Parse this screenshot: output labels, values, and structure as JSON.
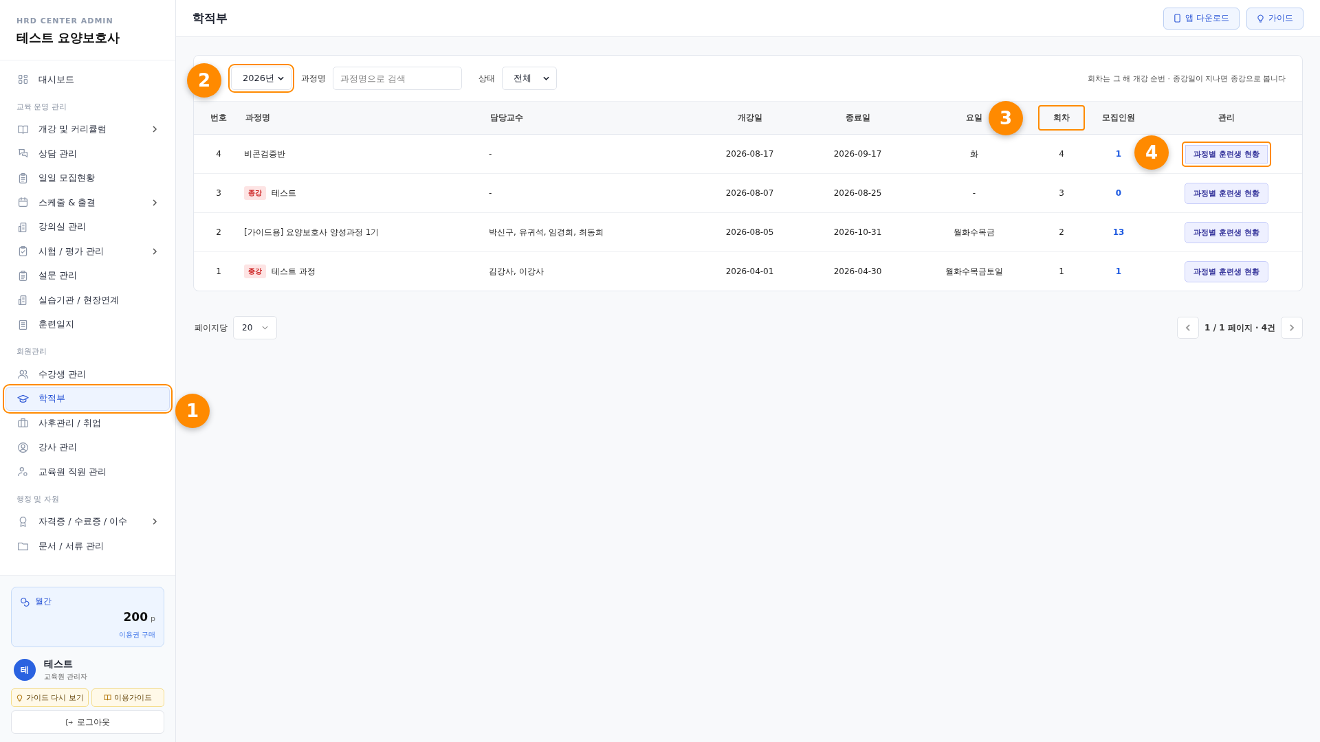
{
  "brand": {
    "subtitle": "HRD CENTER ADMIN",
    "title": "테스트 요양보호사"
  },
  "nav": [
    {
      "kind": "item",
      "label": "대시보드",
      "selected": false,
      "expandable": false,
      "highlighted": false
    },
    {
      "kind": "section",
      "label": "교육 운영 관리"
    },
    {
      "kind": "item",
      "label": "개강 및 커리큘럼",
      "selected": false,
      "expandable": true,
      "highlighted": false
    },
    {
      "kind": "item",
      "label": "상담 관리",
      "selected": false,
      "expandable": false,
      "highlighted": false
    },
    {
      "kind": "item",
      "label": "일일 모집현황",
      "selected": false,
      "expandable": false,
      "highlighted": false
    },
    {
      "kind": "item",
      "label": "스케줄 & 출결",
      "selected": false,
      "expandable": true,
      "highlighted": false
    },
    {
      "kind": "item",
      "label": "강의실 관리",
      "selected": false,
      "expandable": false,
      "highlighted": false
    },
    {
      "kind": "item",
      "label": "시험 / 평가 관리",
      "selected": false,
      "expandable": true,
      "highlighted": false
    },
    {
      "kind": "item",
      "label": "설문 관리",
      "selected": false,
      "expandable": false,
      "highlighted": false
    },
    {
      "kind": "item",
      "label": "실습기관 / 현장연계",
      "selected": false,
      "expandable": false,
      "highlighted": false
    },
    {
      "kind": "item",
      "label": "훈련일지",
      "selected": false,
      "expandable": false,
      "highlighted": false
    },
    {
      "kind": "section",
      "label": "회원관리"
    },
    {
      "kind": "item",
      "label": "수강생 관리",
      "selected": false,
      "expandable": false,
      "highlighted": false
    },
    {
      "kind": "item",
      "label": "학적부",
      "selected": true,
      "expandable": false,
      "highlighted": true
    },
    {
      "kind": "item",
      "label": "사후관리 / 취업",
      "selected": false,
      "expandable": false,
      "highlighted": false
    },
    {
      "kind": "item",
      "label": "강사 관리",
      "selected": false,
      "expandable": false,
      "highlighted": false
    },
    {
      "kind": "item",
      "label": "교육원 직원 관리",
      "selected": false,
      "expandable": false,
      "highlighted": false
    },
    {
      "kind": "section",
      "label": "행정 및 자원"
    },
    {
      "kind": "item",
      "label": "자격증 / 수료증 / 이수",
      "selected": false,
      "expandable": true,
      "highlighted": false
    },
    {
      "kind": "item",
      "label": "문서 / 서류 관리",
      "selected": false,
      "expandable": false,
      "highlighted": false
    }
  ],
  "plan": {
    "label": "월간",
    "points": "200",
    "unit": "p",
    "link": "이용권 구매"
  },
  "user": {
    "initial": "테",
    "name": "테스트",
    "role": "교육원 관리자"
  },
  "guide_buttons": [
    "가이드 다시 보기",
    "이용가이드"
  ],
  "logout": "로그아웃",
  "page_title": "학적부",
  "header_buttons": [
    "앱 다운로드",
    "가이드"
  ],
  "filters": {
    "year": {
      "value": "2026년",
      "highlighted": true
    },
    "course_label": "과정명",
    "course_placeholder": "과정명으로 검색",
    "status_label": "상태",
    "status_value": "전체",
    "note": "회차는 그 해 개강 순번 · 종강일이 지나면 종강으로 봅니다"
  },
  "table": {
    "columns": [
      {
        "label": "번호",
        "highlighted": false
      },
      {
        "label": "과정명",
        "highlighted": false
      },
      {
        "label": "담당교수",
        "highlighted": false
      },
      {
        "label": "개강일",
        "highlighted": false
      },
      {
        "label": "종료일",
        "highlighted": false
      },
      {
        "label": "요일",
        "highlighted": false
      },
      {
        "label": "회차",
        "highlighted": true
      },
      {
        "label": "모집인원",
        "highlighted": false
      },
      {
        "label": "관리",
        "highlighted": false
      }
    ],
    "rows": [
      {
        "no": "4",
        "tag": null,
        "course": "비콘검증반",
        "instructor": "-",
        "start": "2026-08-17",
        "end": "2026-09-17",
        "days": "화",
        "round": "4",
        "enrolled": "1",
        "action": "과정별 훈련생 현황",
        "highlighted": true
      },
      {
        "no": "3",
        "tag": "종강",
        "course": "테스트",
        "instructor": "-",
        "start": "2026-08-07",
        "end": "2026-08-25",
        "days": "-",
        "round": "3",
        "enrolled": "0",
        "action": "과정별 훈련생 현황",
        "highlighted": false
      },
      {
        "no": "2",
        "tag": null,
        "course": "[가이드용] 요양보호사 양성과정 1기",
        "instructor": "박신구, 유귀석, 임경희, 최동희",
        "start": "2026-08-05",
        "end": "2026-10-31",
        "days": "월화수목금",
        "round": "2",
        "enrolled": "13",
        "action": "과정별 훈련생 현황",
        "highlighted": false
      },
      {
        "no": "1",
        "tag": "종강",
        "course": "테스트 과정",
        "instructor": "김강사, 이강사",
        "start": "2026-04-01",
        "end": "2026-04-30",
        "days": "월화수목금토일",
        "round": "1",
        "enrolled": "1",
        "action": "과정별 훈련생 현황",
        "highlighted": false
      }
    ]
  },
  "pagination": {
    "per_page_label": "페이지당",
    "per_page": "20",
    "info": "1 / 1 페이지 · 4건"
  },
  "callouts": [
    {
      "number": "1"
    },
    {
      "number": "2"
    },
    {
      "number": "3"
    },
    {
      "number": "4"
    }
  ]
}
